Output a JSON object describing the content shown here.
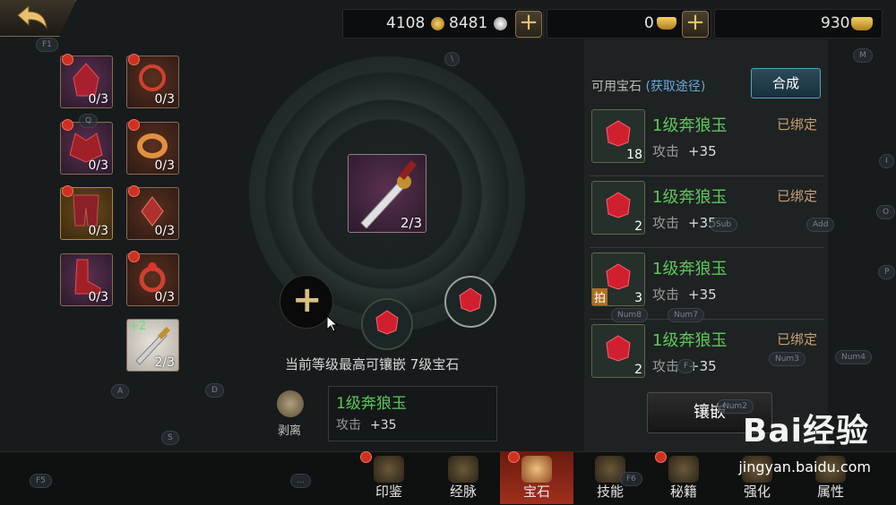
{
  "currencies": {
    "gold": "4108",
    "silver": "8481",
    "ingot": "0",
    "tickets": "930"
  },
  "equipment_slots": [
    {
      "count": "0/3",
      "color": "purple",
      "name": "helmet"
    },
    {
      "count": "0/3",
      "color": "brown",
      "name": "necklace"
    },
    {
      "count": "0/3",
      "color": "purple",
      "name": "shoulder-armor"
    },
    {
      "count": "0/3",
      "color": "brown",
      "name": "bracelet"
    },
    {
      "count": "0/3",
      "color": "gold",
      "name": "leg-armor"
    },
    {
      "count": "0/3",
      "color": "brown",
      "name": "amulet"
    },
    {
      "count": "0/3",
      "color": "purple",
      "name": "boots"
    },
    {
      "count": "0/3",
      "color": "brown",
      "name": "ring"
    },
    {
      "count": "2/3",
      "color": "purple",
      "name": "weapon",
      "badge": "+2"
    }
  ],
  "center": {
    "item_count": "2/3",
    "max_level_text": "当前等级最高可镶嵌 7级宝石",
    "selected_gem": {
      "name": "1级奔狼玉",
      "attr": "攻击",
      "value": "+35"
    },
    "remove_label": "剥离"
  },
  "gem_panel": {
    "title": "可用宝石",
    "obtain": "(获取途径)",
    "compose": "合成",
    "gems": [
      {
        "name": "1级奔狼玉",
        "attr": "攻击",
        "value": "+35",
        "qty": "18",
        "bound": "已绑定"
      },
      {
        "name": "1级奔狼玉",
        "attr": "攻击",
        "value": "+35",
        "qty": "2",
        "bound": "已绑定"
      },
      {
        "name": "1级奔狼玉",
        "attr": "攻击",
        "value": "+35",
        "qty": "3",
        "bound": "",
        "tag": "拍"
      },
      {
        "name": "1级奔狼玉",
        "attr": "攻击",
        "value": "+35",
        "qty": "2",
        "bound": "已绑定"
      }
    ],
    "inlay": "镶嵌"
  },
  "tabs": [
    {
      "label": "印鉴",
      "active": false,
      "dot": true
    },
    {
      "label": "经脉",
      "active": false,
      "dot": false
    },
    {
      "label": "宝石",
      "active": true,
      "dot": true
    },
    {
      "label": "技能",
      "active": false,
      "dot": false
    },
    {
      "label": "秘籍",
      "active": false,
      "dot": true
    },
    {
      "label": "强化",
      "active": false,
      "dot": false
    },
    {
      "label": "属性",
      "active": false,
      "dot": false
    }
  ],
  "key_hints": [
    "F1",
    "\\",
    "M",
    "Q",
    "I",
    "O",
    "P",
    "Add",
    "Sub",
    "Num8",
    "Num7",
    "Num3",
    "Num4",
    "A",
    "D",
    "S",
    "F5",
    "...",
    "F",
    "F6",
    "Num2"
  ],
  "watermark": {
    "brand": "Bai经验",
    "url": "jingyan.baidu.com"
  },
  "colors": {
    "accent_green": "#5cc85a",
    "bound_tan": "#c8a070",
    "active_tab": "#a0301c"
  }
}
